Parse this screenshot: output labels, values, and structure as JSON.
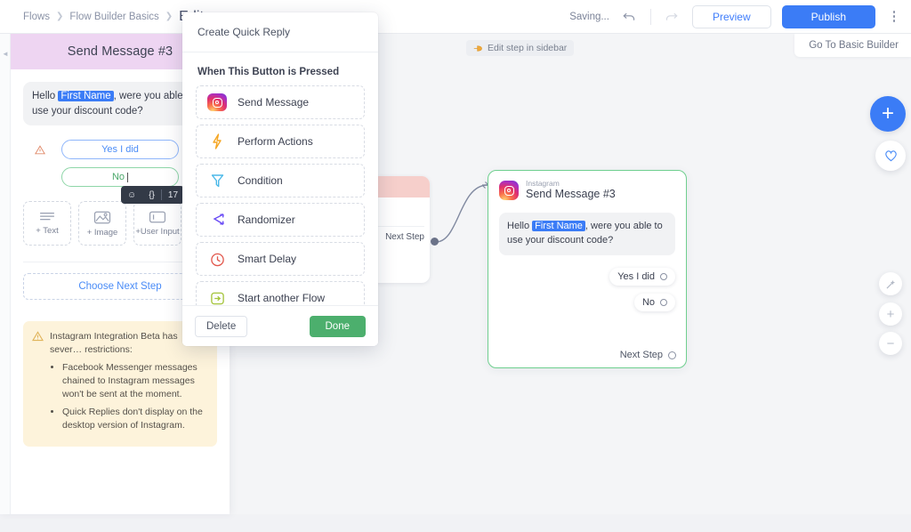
{
  "topbar": {
    "breadcrumb": [
      "Flows",
      "Flow Builder Basics"
    ],
    "current": "Edit",
    "saving": "Saving...",
    "undo_icon": "undo-icon",
    "redo_icon": "redo-icon",
    "preview_label": "Preview",
    "publish_label": "Publish",
    "more_icon": "kebab-menu-icon"
  },
  "canvas_bar": {
    "go_to_basic": "Go To Basic Builder",
    "edit_step_pill": "Edit step in sidebar",
    "edit_step_icon": "pointing-hand-icon"
  },
  "sidebar": {
    "collapse_icon": "chevron-left-icon",
    "title": "Send Message #3",
    "message": {
      "before": "Hello ",
      "variable": "First Name",
      "after": ", were you able to use your discount code?"
    },
    "warning_icon": "warning-triangle-icon",
    "quick_replies": [
      {
        "label": "Yes I did",
        "color": "#4a8cf7"
      },
      {
        "label": "No",
        "color": "#4aa86a",
        "editing": true
      }
    ],
    "editor_toolbar": {
      "emoji_icon": "emoji-icon",
      "variable_icon": "curly-braces-icon",
      "char_count": "17"
    },
    "add_blocks": [
      {
        "label": "+ Text",
        "icon": "text-lines-icon"
      },
      {
        "label": "+ Image",
        "icon": "image-icon"
      },
      {
        "label": "+User Input",
        "icon": "user-input-icon"
      }
    ],
    "choose_next_step": "Choose Next Step",
    "beta_note": {
      "icon": "warning-triangle-icon",
      "heading": "Instagram Integration Beta has sever… restrictions:",
      "bullets": [
        "Facebook Messenger messages chained to Instagram messages won't be sent at the moment.",
        "Quick Replies don't display on the desktop version of Instagram."
      ]
    }
  },
  "popup": {
    "header": "Create Quick Reply",
    "section_title": "When This Button is Pressed",
    "items": [
      {
        "label": "Send Message",
        "icon": "instagram-icon",
        "color": "#e1306c"
      },
      {
        "label": "Perform Actions",
        "icon": "lightning-bolt-icon",
        "color": "#f5a623"
      },
      {
        "label": "Condition",
        "icon": "funnel-filter-icon",
        "color": "#4ab8e8"
      },
      {
        "label": "Randomizer",
        "icon": "shuffle-arrows-icon",
        "color": "#6b4df5"
      },
      {
        "label": "Smart Delay",
        "icon": "clock-icon",
        "color": "#e2574c"
      },
      {
        "label": "Start another Flow",
        "icon": "arrow-into-box-icon",
        "color": "#a4c43a"
      }
    ],
    "delete_label": "Delete",
    "done_label": "Done"
  },
  "flow": {
    "hidden_node": {
      "next_step": "Next Step"
    },
    "main_node": {
      "platform": "Instagram",
      "platform_icon": "instagram-icon",
      "title": "Send Message #3",
      "message": {
        "before": "Hello ",
        "variable": "First Name",
        "after": ", were you able to use your discount code?"
      },
      "replies": [
        "Yes I did",
        "No"
      ],
      "next_step": "Next Step",
      "border_color": "#6fcf8f"
    }
  },
  "controls": {
    "add": {
      "icon": "plus-icon",
      "label": "+"
    },
    "favorite": {
      "icon": "heart-icon"
    },
    "magic": {
      "icon": "magic-wand-icon"
    },
    "zoom_in": {
      "icon": "plus-icon",
      "label": "+"
    },
    "zoom_out": {
      "icon": "minus-icon",
      "label": "−"
    }
  }
}
